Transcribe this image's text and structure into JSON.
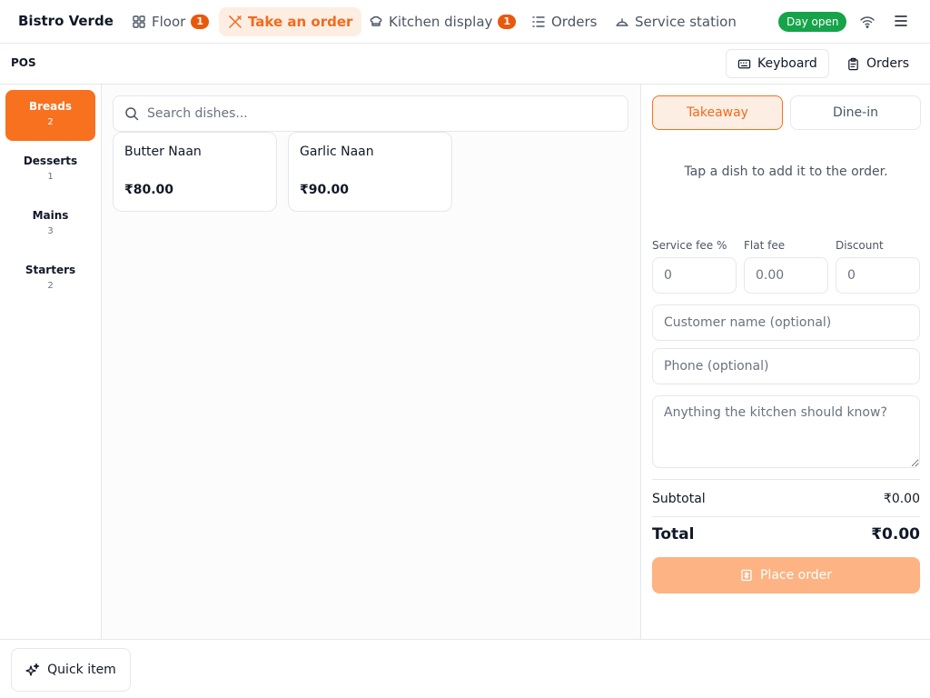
{
  "app": {
    "brand": "Bistro Verde",
    "nav": [
      {
        "label": "Floor",
        "badge": "1",
        "icon": "grid-icon"
      },
      {
        "label": "Take an order",
        "icon": "utensils-icon"
      },
      {
        "label": "Kitchen display",
        "badge": "1",
        "icon": "chef-hat-icon"
      },
      {
        "label": "Orders",
        "icon": "list-icon"
      },
      {
        "label": "Service station",
        "icon": "cloche-icon"
      }
    ],
    "day_status": "Day open"
  },
  "subbar": {
    "title": "POS",
    "keyboard_label": "Keyboard",
    "orders_label": "Orders"
  },
  "categories": [
    {
      "name": "Breads",
      "count": "2"
    },
    {
      "name": "Desserts",
      "count": "1"
    },
    {
      "name": "Mains",
      "count": "3"
    },
    {
      "name": "Starters",
      "count": "2"
    }
  ],
  "search": {
    "placeholder": "Search dishes..."
  },
  "dishes": [
    {
      "name": "Butter Naan",
      "price": "₹80.00"
    },
    {
      "name": "Garlic Naan",
      "price": "₹90.00"
    }
  ],
  "order": {
    "mode_takeaway": "Takeaway",
    "mode_dinein": "Dine-in",
    "empty_hint": "Tap a dish to add it to the order.",
    "service_fee_label": "Service fee %",
    "service_fee_placeholder": "0",
    "flat_fee_label": "Flat fee",
    "flat_fee_placeholder": "0.00",
    "discount_label": "Discount",
    "discount_placeholder": "0",
    "customer_placeholder": "Customer name (optional)",
    "phone_placeholder": "Phone (optional)",
    "notes_placeholder": "Anything the kitchen should know?",
    "subtotal_label": "Subtotal",
    "subtotal_value": "₹0.00",
    "total_label": "Total",
    "total_value": "₹0.00",
    "place_order_label": "Place order"
  },
  "footer": {
    "quick_item_label": "Quick item"
  },
  "colors": {
    "accent": "#f7711f",
    "accent_soft": "#fdeee4",
    "success": "#16a34a"
  }
}
